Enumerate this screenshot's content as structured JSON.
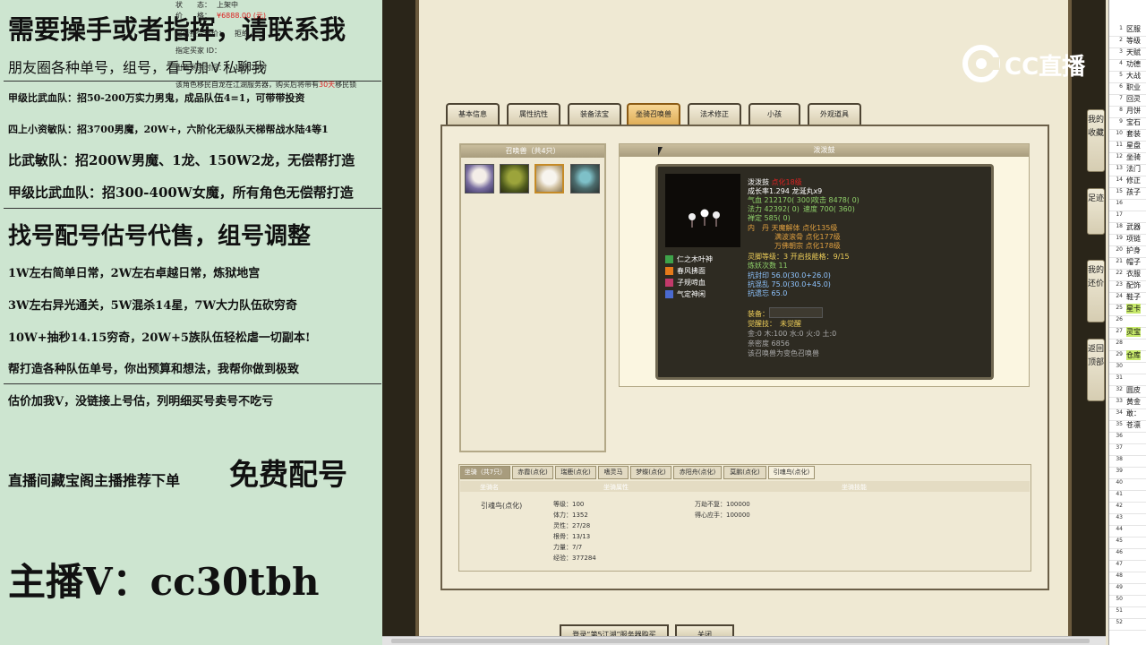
{
  "ad": {
    "lines": [
      "需要操手或者指挥，请联系我",
      "朋友圈各种单号，组号，看号加Ｖ私聊我",
      "甲级比武血队：招50-200万实力男鬼，成品队伍4=1，可带带投资",
      "四上小资敏队：招3700男魔，20W+，六阶化无级队天梯帮战水陆4等1",
      "比武敏队：招200W男魔、1龙、150W2龙，无偿帮打造",
      "甲级比武血队：招300-400W女魔，所有角色无偿帮打造",
      "找号配号估号代售，组号调整",
      "1W左右简单日常，2W左右卓越日常，炼狱地宫",
      "3W左右异光通关，5W混杀14星，7W大力队伍砍穷奇",
      "10W+抽秒14.15穷奇，20W+5族队伍轻松虐一切副本!",
      "帮打造各种队伍单号，你出预算和想法，我帮你做到极致",
      "估价加我V，没链接上号估，列明细买号卖号不吃亏",
      "直播间藏宝阁主播推荐下单",
      "免费配号",
      "主播V：cc30tbh"
    ]
  },
  "listing": {
    "price_label": "价　　格：",
    "price": "¥6888.00 (元)",
    "counter_label": "是否接受还价：",
    "counter": "拒绝",
    "buyer_label": "指定买家 ID：",
    "remain_label": "出售剩余时间：",
    "remain": "10天23时",
    "notice_pre": "该角色移民自龙在江湖服务器，购买后将带有",
    "notice_days": "30天",
    "notice_post": "移民锁"
  },
  "tabs": [
    "基本信息",
    "属性抗性",
    "装备法宝",
    "坐骑召唤兽",
    "法术修正",
    "小孩",
    "外观道具"
  ],
  "pet_list": {
    "title": "召唤兽（共4只）",
    "icons": [
      "mask-pet-icon",
      "goblin-pet-icon",
      "ghost-pet-icon",
      "warrior-pet-icon"
    ]
  },
  "pet_detail": {
    "title": "泼泼鼓",
    "name": "泼泼鼓",
    "name_suffix": "点化18级",
    "growth": "成长率1.294 龙涎丸x9",
    "hp": "气血 212170( 300)",
    "atk": "攻击 8478( 0)",
    "mp": "法力 42392( 0)",
    "spd": "速度 700( 360)",
    "def": "禅定 585( 0)",
    "inner1": "内　丹 天魔解体 点化135级",
    "inner2": "满波滚骨 点化177级",
    "inner3": "万佛朝宗 点化178级",
    "skill_lv": "灵脚等级：3 开启技能格：9/15",
    "refine": "炼妖次数 11",
    "res1": "抗封印 56.0(30.0+26.0)",
    "res2": "抗混乱 75.0(30.0+45.0)",
    "res3": "抗遗忘 65.0",
    "equip": "装备：",
    "awaken": "觉醒技：　未觉醒",
    "elements": "金:0 木:100 水:0 火:0 土:0",
    "intimacy": "亲密度 6856",
    "note": "该召唤兽为变色召唤兽",
    "skills": [
      "仁之木叶神",
      "春风拂面",
      "子规啼血",
      "气定神闲"
    ]
  },
  "mount_tabs": [
    "坐骑（共7只）",
    "赤霞(点化)",
    "瑞鹿(点化)",
    "嗜灵马",
    "梦蝶(点化)",
    "赤阳舟(点化)",
    "莫鹏(点化)",
    "引魂鸟(点化)"
  ],
  "mount": {
    "col_name": "坐骑名",
    "col_attr": "坐骑属性",
    "col_skill": "坐骑技能",
    "name": "引魂鸟(点化)",
    "attrs": [
      "等级：100",
      "体力：1352",
      "灵性：27/28",
      "根骨：13/13",
      "力量：7/7",
      "经验：377284"
    ],
    "skills": [
      "万劫不复：100000",
      "得心应手：100000"
    ]
  },
  "buttons": {
    "left": "登录“第5江湖”服务器购买",
    "right": "关闭"
  },
  "side": [
    "我的收藏",
    "足迹",
    "我的还价",
    "返回顶部"
  ],
  "sheet": {
    "cells": [
      "区服",
      "等级",
      "天赋",
      "功德",
      "大战",
      "职业",
      "回灵",
      "月饼",
      "宝石",
      "套装",
      "星盘",
      "坐骑",
      "法门",
      "修正",
      "孩子",
      "",
      "",
      "武器",
      "项链",
      "护身",
      "帽子",
      "衣服",
      "配饰",
      "鞋子",
      "星卡",
      "",
      "灵宝",
      "",
      "仓库",
      "",
      "",
      "圆皮",
      "黄金",
      "敢：",
      "苍凛"
    ]
  },
  "brand": "CC直播"
}
